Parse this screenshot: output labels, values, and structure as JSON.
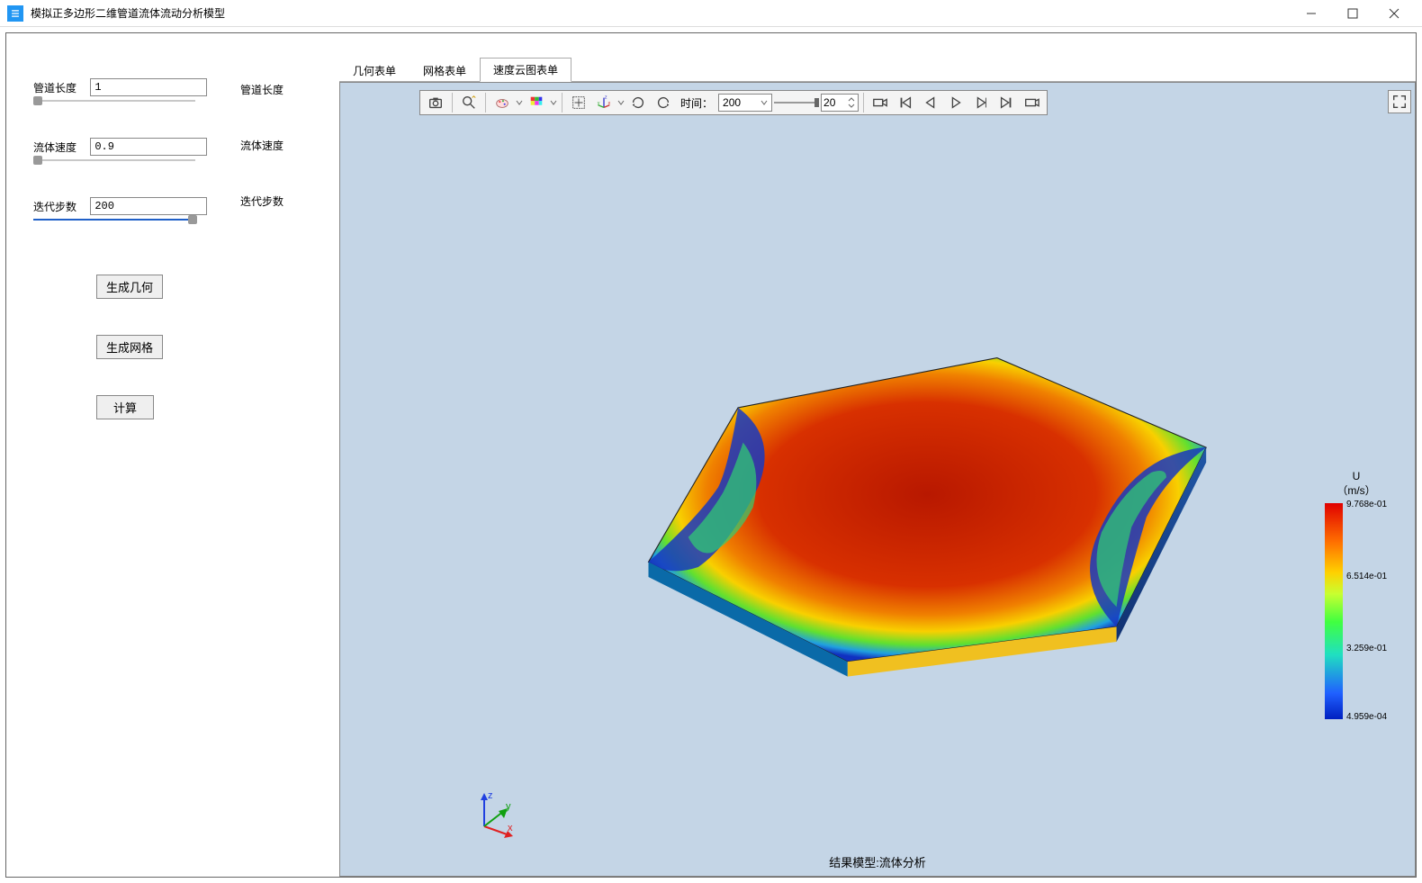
{
  "window": {
    "title": "模拟正多边形二维管道流体流动分析模型"
  },
  "params": {
    "length": {
      "label": "管道长度",
      "value": "1",
      "echo": "管道长度"
    },
    "velocity": {
      "label": "流体速度",
      "value": "0.9",
      "echo": "流体速度"
    },
    "steps": {
      "label": "迭代步数",
      "value": "200",
      "echo": "迭代步数"
    }
  },
  "buttons": {
    "gen_geom": "生成几何",
    "gen_mesh": "生成网格",
    "compute": "计算"
  },
  "tabs": {
    "geom": "几何表单",
    "mesh": "网格表单",
    "contour": "速度云图表单"
  },
  "toolbar": {
    "time_label": "时间：",
    "time_value": "200",
    "fps_value": "20"
  },
  "legend": {
    "title_line1": "U",
    "title_line2": "（m/s）",
    "ticks": {
      "max": "9.768e-01",
      "t2": "6.514e-01",
      "t3": "3.259e-01",
      "min": "4.959e-04"
    }
  },
  "axes": {
    "x": "x",
    "y": "y",
    "z": "z"
  },
  "caption": "结果模型:流体分析"
}
